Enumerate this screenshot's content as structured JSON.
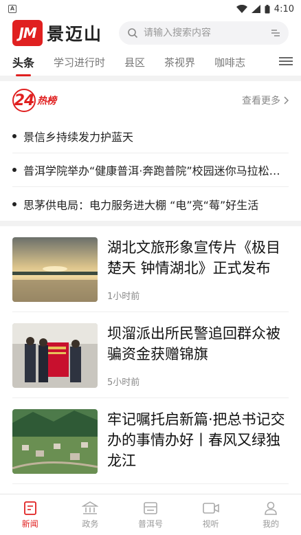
{
  "status_bar": {
    "time": "4:10",
    "left_icon": "A"
  },
  "header": {
    "logo_mark": "JM",
    "logo_text": "景迈山",
    "search_placeholder": "请输入搜索内容"
  },
  "tabs": [
    {
      "label": "头条",
      "active": true
    },
    {
      "label": "学习进行时",
      "active": false
    },
    {
      "label": "县区",
      "active": false
    },
    {
      "label": "茶视界",
      "active": false
    },
    {
      "label": "咖啡志",
      "active": false
    }
  ],
  "hot": {
    "logo_number": "24",
    "logo_text": "热榜",
    "more_label": "查看更多",
    "items": [
      "景信乡持续发力护蓝天",
      "普洱学院举办“健康普洱·奔跑普院”校园迷你马拉松比赛",
      "思茅供电局：电力服务进大棚 “电”亮“莓”好生活"
    ]
  },
  "news": [
    {
      "title": "湖北文旅形象宣传片《极目楚天 钟情湖北》正式发布",
      "time": "1小时前",
      "thumb": "river-sunset"
    },
    {
      "title": "坝溜派出所民警追回群众被骗资金获赠锦旗",
      "time": "5小时前",
      "thumb": "police-banner"
    },
    {
      "title": "牢记嘱托启新篇·把总书记交办的事情办好丨春风又绿独龙江",
      "time": "",
      "thumb": "village-valley"
    }
  ],
  "bottom_nav": [
    {
      "label": "新闻",
      "icon": "news-icon",
      "active": true
    },
    {
      "label": "政务",
      "icon": "government-icon",
      "active": false
    },
    {
      "label": "普洱号",
      "icon": "puer-account-icon",
      "active": false
    },
    {
      "label": "视听",
      "icon": "video-icon",
      "active": false
    },
    {
      "label": "我的",
      "icon": "profile-icon",
      "active": false
    }
  ],
  "colors": {
    "accent": "#e02020",
    "muted": "#999999"
  }
}
